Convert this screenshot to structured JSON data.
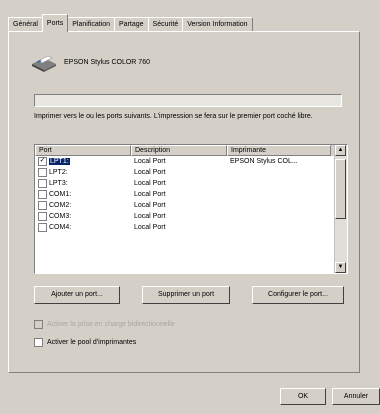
{
  "tabs": [
    "Général",
    "Ports",
    "Planification",
    "Partage",
    "Sécurité",
    "Version Information"
  ],
  "active_tab": "Ports",
  "printer": {
    "name": "EPSON Stylus COLOR 760"
  },
  "instruction": "Imprimer vers le ou les ports suivants. L'impression se fera sur le premier port coché libre.",
  "list": {
    "headers": {
      "port": "Port",
      "description": "Description",
      "printer": "Imprimante"
    },
    "rows": [
      {
        "port": "LPT1:",
        "description": "Local Port",
        "printer": "EPSON Stylus COL...",
        "checked": true,
        "selected": true
      },
      {
        "port": "LPT2:",
        "description": "Local Port",
        "printer": "",
        "checked": false,
        "selected": false
      },
      {
        "port": "LPT3:",
        "description": "Local Port",
        "printer": "",
        "checked": false,
        "selected": false
      },
      {
        "port": "COM1:",
        "description": "Local Port",
        "printer": "",
        "checked": false,
        "selected": false
      },
      {
        "port": "COM2:",
        "description": "Local Port",
        "printer": "",
        "checked": false,
        "selected": false
      },
      {
        "port": "COM3:",
        "description": "Local Port",
        "printer": "",
        "checked": false,
        "selected": false
      },
      {
        "port": "COM4:",
        "description": "Local Port",
        "printer": "",
        "checked": false,
        "selected": false
      }
    ]
  },
  "buttons": {
    "add_port": "Ajouter un port...",
    "delete_port": "Supprimer un port",
    "configure_port": "Configurer le port...",
    "ok": "OK",
    "cancel": "Annuler"
  },
  "options": {
    "bidirectional": "Activer la prise en charge bidirectionnelle",
    "pooling": "Activer le pool d'imprimantes"
  },
  "colors": {
    "selection": "#0a246a",
    "face": "#d4d0c8"
  }
}
